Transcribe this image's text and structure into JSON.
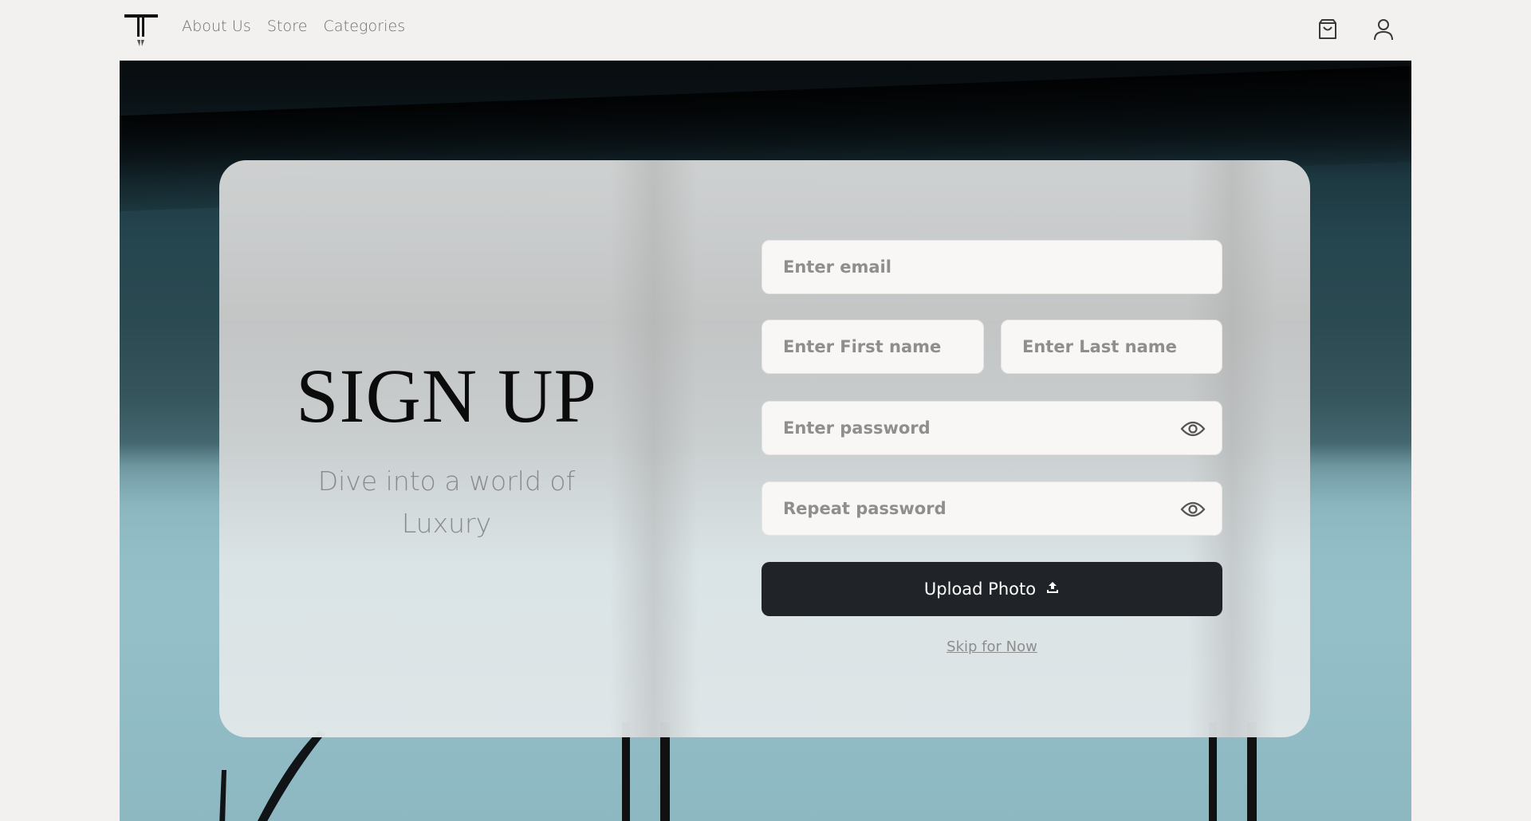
{
  "nav": {
    "links": [
      "About Us",
      "Store",
      "Categories"
    ]
  },
  "icons": {
    "logo": "brand-logo",
    "cart": "shopping-bag-icon",
    "user": "user-icon",
    "eye": "eye-icon",
    "upload": "upload-icon"
  },
  "signup": {
    "title": "SIGN UP",
    "subtitle": "Dive into a world of Luxury",
    "email_placeholder": "Enter email",
    "first_name_placeholder": "Enter First name",
    "last_name_placeholder": "Enter Last name",
    "password_placeholder": "Enter password",
    "repeat_password_placeholder": "Repeat password",
    "upload_label": "Upload Photo",
    "skip_label": "Skip for Now"
  },
  "colors": {
    "background": "#f2f1ef",
    "button": "#202327",
    "nav_text": "#6e6e6e"
  }
}
